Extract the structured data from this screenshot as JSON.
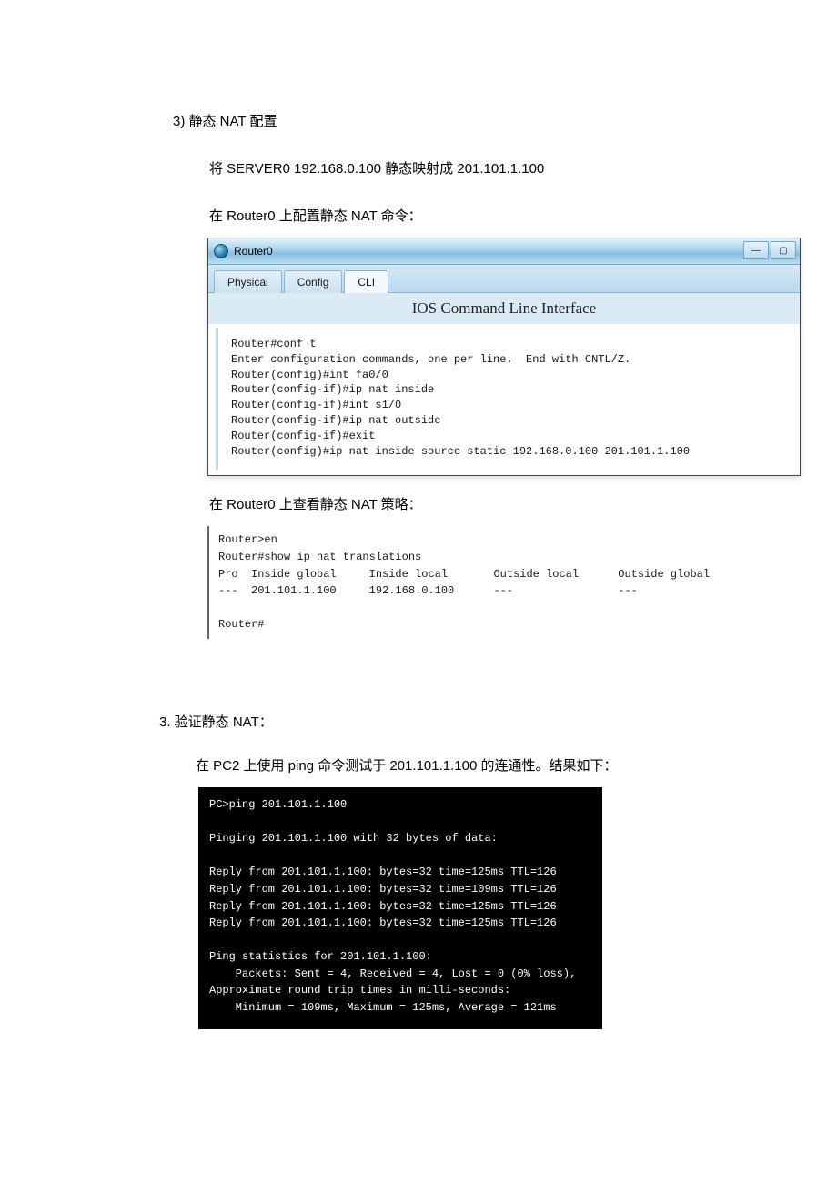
{
  "section3": {
    "title": "3)   静态 NAT 配置",
    "line1": "将 SERVER0 192.168.0.100 静态映射成 201.101.1.100",
    "line2": "在 Router0 上配置静态 NAT 命令："
  },
  "routerWindow": {
    "title": "Router0",
    "tabs": {
      "physical": "Physical",
      "config": "Config",
      "cli": "CLI"
    },
    "cliTitle": "IOS Command Line Interface",
    "cliBody": "Router#conf t\nEnter configuration commands, one per line.  End with CNTL/Z.\nRouter(config)#int fa0/0\nRouter(config-if)#ip nat inside\nRouter(config-if)#int s1/0\nRouter(config-if)#ip nat outside\nRouter(config-if)#exit\nRouter(config)#ip nat inside source static 192.168.0.100 201.101.1.100"
  },
  "afterRouter": {
    "line": "在 Router0 上查看静态 NAT 策略："
  },
  "natTable": "Router>en\nRouter#show ip nat translations\nPro  Inside global     Inside local       Outside local      Outside global\n---  201.101.1.100     192.168.0.100      ---                ---\n\nRouter#",
  "verify": {
    "heading": "3.  验证静态 NAT：",
    "line": "在 PC2 上使用 ping 命令测试于 201.101.1.100 的连通性。结果如下："
  },
  "ping": "PC>ping 201.101.1.100\n\nPinging 201.101.1.100 with 32 bytes of data:\n\nReply from 201.101.1.100: bytes=32 time=125ms TTL=126\nReply from 201.101.1.100: bytes=32 time=109ms TTL=126\nReply from 201.101.1.100: bytes=32 time=125ms TTL=126\nReply from 201.101.1.100: bytes=32 time=125ms TTL=126\n\nPing statistics for 201.101.1.100:\n    Packets: Sent = 4, Received = 4, Lost = 0 (0% loss),\nApproximate round trip times in milli-seconds:\n    Minimum = 109ms, Maximum = 125ms, Average = 121ms"
}
